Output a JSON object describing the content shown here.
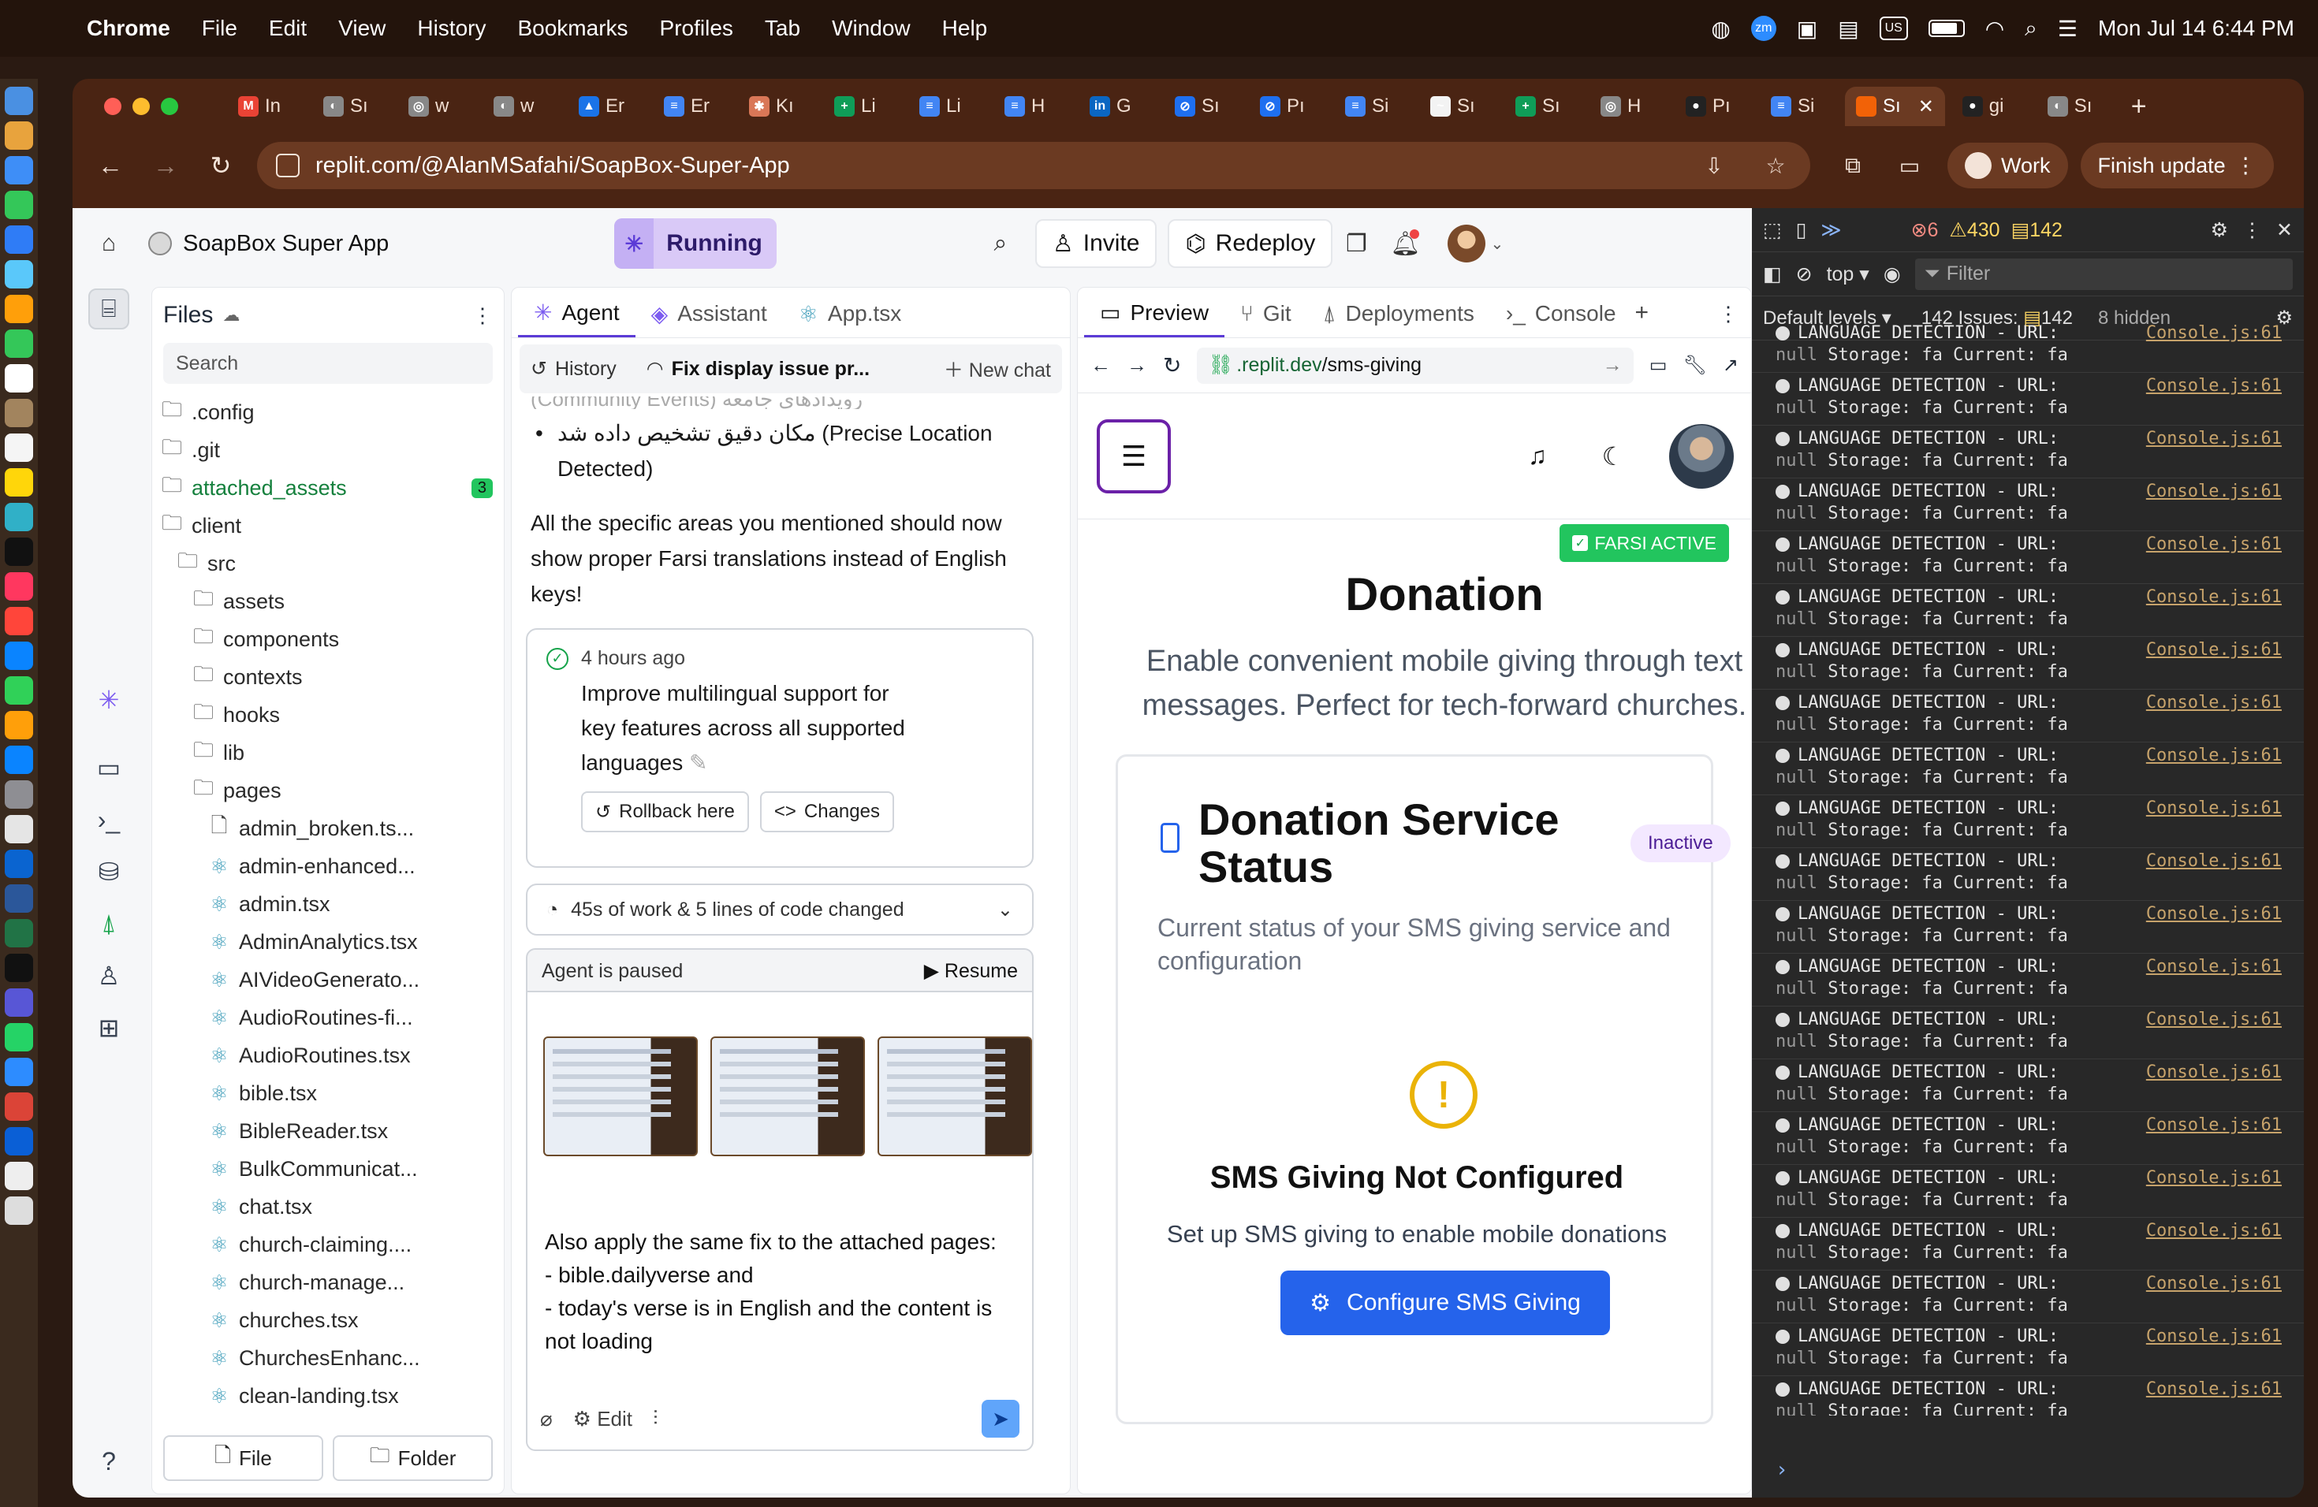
{
  "menubar": {
    "app": "Chrome",
    "items": [
      "File",
      "Edit",
      "View",
      "History",
      "Bookmarks",
      "Profiles",
      "Tab",
      "Window",
      "Help"
    ],
    "tray": {
      "zm": "zm",
      "us": "US",
      "datetime": "Mon Jul 14  6:44 PM"
    }
  },
  "browser": {
    "tabs": [
      {
        "label": "In",
        "icon": "gmail-icon",
        "color": "#ea4335",
        "glyph": "M"
      },
      {
        "label": "Sı",
        "icon": "globe-icon",
        "color": "#888",
        "glyph": "◐"
      },
      {
        "label": "w",
        "icon": "openai-icon",
        "color": "#888",
        "glyph": "◎"
      },
      {
        "label": "w",
        "icon": "globe-icon",
        "color": "#888",
        "glyph": "◐"
      },
      {
        "label": "Er",
        "icon": "drive-icon",
        "color": "#1a73e8",
        "glyph": "▲"
      },
      {
        "label": "Er",
        "icon": "docs-icon",
        "color": "#4285f4",
        "glyph": "≡"
      },
      {
        "label": "Kı",
        "icon": "claude-icon",
        "color": "#d97757",
        "glyph": "✱"
      },
      {
        "label": "Li",
        "icon": "sheets-icon",
        "color": "#0f9d58",
        "glyph": "+"
      },
      {
        "label": "Li",
        "icon": "docs-icon",
        "color": "#4285f4",
        "glyph": "≡"
      },
      {
        "label": "H",
        "icon": "docs-icon",
        "color": "#4285f4",
        "glyph": "≡"
      },
      {
        "label": "G",
        "icon": "linkedin-icon",
        "color": "#0a66c2",
        "glyph": "in"
      },
      {
        "label": "Sı",
        "icon": "safari-icon",
        "color": "#1e6ff0",
        "glyph": "⊘"
      },
      {
        "label": "Pı",
        "icon": "safari-icon",
        "color": "#1e6ff0",
        "glyph": "⊘"
      },
      {
        "label": "Si",
        "icon": "docs-icon",
        "color": "#4285f4",
        "glyph": "≡"
      },
      {
        "label": "Sı",
        "icon": "slides-icon",
        "color": "#f3f3f3",
        "glyph": "~"
      },
      {
        "label": "Sı",
        "icon": "sheets-icon",
        "color": "#0f9d58",
        "glyph": "+"
      },
      {
        "label": "H",
        "icon": "openai-icon",
        "color": "#888",
        "glyph": "◎"
      },
      {
        "label": "Pı",
        "icon": "github-icon",
        "color": "#222",
        "glyph": "●"
      },
      {
        "label": "Si",
        "icon": "docs-icon",
        "color": "#4285f4",
        "glyph": "≡"
      },
      {
        "label": "Sı",
        "icon": "replit-icon",
        "color": "#f26207",
        "glyph": "",
        "active": true
      },
      {
        "label": "gi",
        "icon": "github-icon",
        "color": "#222",
        "glyph": "●"
      },
      {
        "label": "Sı",
        "icon": "globe-icon",
        "color": "#888",
        "glyph": "◐"
      }
    ],
    "url": "replit.com/@AlanMSafahi/SoapBox-Super-App",
    "profile": "Work",
    "finish_update": "Finish update"
  },
  "replit": {
    "project_name": "SoapBox Super App",
    "status": "Running",
    "invite": "Invite",
    "redeploy": "Redeploy",
    "files": {
      "title": "Files",
      "search_placeholder": "Search",
      "tree": [
        {
          "name": ".config",
          "type": "folder",
          "depth": 0
        },
        {
          "name": ".git",
          "type": "folder",
          "depth": 0
        },
        {
          "name": "attached_assets",
          "type": "folder",
          "depth": 0,
          "badge": "3"
        },
        {
          "name": "client",
          "type": "folder",
          "depth": 0
        },
        {
          "name": "src",
          "type": "folder",
          "depth": 1
        },
        {
          "name": "assets",
          "type": "folder",
          "depth": 2
        },
        {
          "name": "components",
          "type": "folder",
          "depth": 2
        },
        {
          "name": "contexts",
          "type": "folder",
          "depth": 2
        },
        {
          "name": "hooks",
          "type": "folder",
          "depth": 2
        },
        {
          "name": "lib",
          "type": "folder",
          "depth": 2
        },
        {
          "name": "pages",
          "type": "folder",
          "depth": 2
        },
        {
          "name": "admin_broken.ts...",
          "type": "file",
          "depth": 3
        },
        {
          "name": "admin-enhanced...",
          "type": "react",
          "depth": 3
        },
        {
          "name": "admin.tsx",
          "type": "react",
          "depth": 3
        },
        {
          "name": "AdminAnalytics.tsx",
          "type": "react",
          "depth": 3
        },
        {
          "name": "AIVideoGenerato...",
          "type": "react",
          "depth": 3
        },
        {
          "name": "AudioRoutines-fi...",
          "type": "react",
          "depth": 3
        },
        {
          "name": "AudioRoutines.tsx",
          "type": "react",
          "depth": 3
        },
        {
          "name": "bible.tsx",
          "type": "react",
          "depth": 3
        },
        {
          "name": "BibleReader.tsx",
          "type": "react",
          "depth": 3
        },
        {
          "name": "BulkCommunicat...",
          "type": "react",
          "depth": 3
        },
        {
          "name": "chat.tsx",
          "type": "react",
          "depth": 3
        },
        {
          "name": "church-claiming....",
          "type": "react",
          "depth": 3
        },
        {
          "name": "church-manage...",
          "type": "react",
          "depth": 3
        },
        {
          "name": "churches.tsx",
          "type": "react",
          "depth": 3
        },
        {
          "name": "ChurchesEnhanc...",
          "type": "react",
          "depth": 3
        },
        {
          "name": "clean-landing.tsx",
          "type": "react",
          "depth": 3
        }
      ],
      "new_file": "File",
      "new_folder": "Folder"
    },
    "agent": {
      "tabs": [
        "Agent",
        "Assistant",
        "App.tsx"
      ],
      "history": "History",
      "chat_title": "Fix display issue pr...",
      "new_chat": "New chat",
      "faded_line": "رویدادهای جامعه (Community Events)",
      "bullet": "مکان دقیق تشخیص داده شد (Precise Location Detected)",
      "summary": "All the specific areas you mentioned should now show proper Farsi translations instead of English keys!",
      "checkpoint": {
        "time": "4 hours ago",
        "text": "Improve multilingual support for key features across all supported languages",
        "rollback": "Rollback here",
        "changes": "Changes"
      },
      "work_summary": "45s of work & 5 lines of code changed",
      "paused": "Agent is paused",
      "resume": "Resume",
      "composer_text": [
        "Also apply the same fix to the attached pages:",
        "- bible.dailyverse and",
        "- today's verse is in English and the content is not loading"
      ],
      "edit": "Edit"
    },
    "preview": {
      "tabs": [
        "Preview",
        "Git",
        "Deployments",
        "Console"
      ],
      "url_prefix": ".replit.dev",
      "url_path": "/sms-giving",
      "badge": "FARSI ACTIVE",
      "title": "Donation",
      "subtitle": "Enable convenient mobile giving through text messages. Perfect for tech-forward churches.",
      "card_title": "Donation Service Status",
      "card_status": "Inactive",
      "card_desc": "Current status of your SMS giving service and configuration",
      "empty_title": "SMS Giving Not Configured",
      "empty_desc": "Set up SMS giving to enable mobile donations",
      "cta": "Configure SMS Giving",
      "colors": {
        "cta": "#2563eb",
        "badge": "#22c55e",
        "warning": "#eab308"
      }
    }
  },
  "devtools": {
    "errors": "6",
    "warnings": "430",
    "messages": "142",
    "context": "top",
    "filter_placeholder": "Filter",
    "levels": "Default levels",
    "issues_label": "142 Issues:",
    "issues_count": "142",
    "hidden": "8 hidden",
    "log_line1": "LANGUAGE DETECTION - URL:",
    "log_null": "null",
    "log_line2": " Storage: fa Current: fa",
    "log_source": "Console.js:61",
    "log_count": 21,
    "prompt": "›"
  }
}
